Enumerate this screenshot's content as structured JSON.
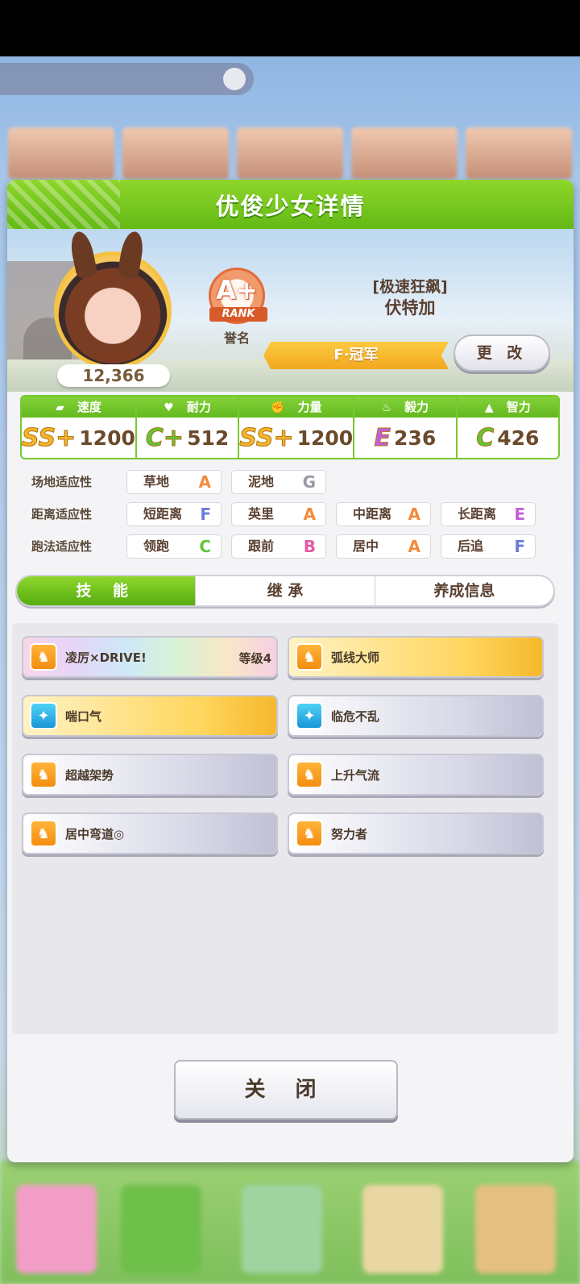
{
  "dialog": {
    "title": "优俊少女详情"
  },
  "profile": {
    "fans_count": "12,366",
    "rank": {
      "letter": "A+",
      "ribbon": "RANK",
      "caption": "誉名"
    },
    "nickname": "[极速狂飙]",
    "name": "伏特加",
    "title": "F·冠军",
    "change_label": "更 改"
  },
  "stats": [
    {
      "label": "速度",
      "icon": "shoe-icon",
      "grade": "SS+",
      "value": "1200",
      "grade_color": "#f5b52a"
    },
    {
      "label": "耐力",
      "icon": "heart-icon",
      "grade": "C+",
      "value": "512",
      "grade_color": "#62c43a"
    },
    {
      "label": "力量",
      "icon": "muscle-icon",
      "grade": "SS+",
      "value": "1200",
      "grade_color": "#f5b52a"
    },
    {
      "label": "毅力",
      "icon": "flame-icon",
      "grade": "E",
      "value": "236",
      "grade_color": "#c25fd8"
    },
    {
      "label": "智力",
      "icon": "graduation-cap-icon",
      "grade": "C",
      "value": "426",
      "grade_color": "#62c43a"
    }
  ],
  "aptitudes": [
    {
      "label": "场地适应性",
      "cells": [
        {
          "name": "草地",
          "grade": "A"
        },
        {
          "name": "泥地",
          "grade": "G"
        }
      ]
    },
    {
      "label": "距离适应性",
      "cells": [
        {
          "name": "短距离",
          "grade": "F"
        },
        {
          "name": "英里",
          "grade": "A"
        },
        {
          "name": "中距离",
          "grade": "A"
        },
        {
          "name": "长距离",
          "grade": "E"
        }
      ]
    },
    {
      "label": "跑法适应性",
      "cells": [
        {
          "name": "领跑",
          "grade": "C"
        },
        {
          "name": "跟前",
          "grade": "B"
        },
        {
          "name": "居中",
          "grade": "A"
        },
        {
          "name": "后追",
          "grade": "F"
        }
      ]
    }
  ],
  "grade_colors": {
    "A": "#f58a3c",
    "B": "#e45aa5",
    "C": "#62c43a",
    "E": "#c25fd8",
    "F": "#6b7cd8",
    "G": "#9a9aa6"
  },
  "tabs": [
    "技 能",
    "继 承",
    "养成信息"
  ],
  "skills": [
    {
      "name": "凌厉×DRIVE!",
      "level": "等级4",
      "style": "rainbow",
      "icon": "orange"
    },
    {
      "name": "弧线大师",
      "level": "",
      "style": "gold",
      "icon": "orange"
    },
    {
      "name": "喘口气",
      "level": "",
      "style": "gold",
      "icon": "blue"
    },
    {
      "name": "临危不乱",
      "level": "",
      "style": "normal",
      "icon": "blue"
    },
    {
      "name": "超越架势",
      "level": "",
      "style": "normal",
      "icon": "orange"
    },
    {
      "name": "上升气流",
      "level": "",
      "style": "normal",
      "icon": "orange"
    },
    {
      "name": "居中弯道◎",
      "level": "",
      "style": "normal",
      "icon": "orange"
    },
    {
      "name": "努力者",
      "level": "",
      "style": "normal",
      "icon": "orange"
    }
  ],
  "close_label": "关 闭"
}
